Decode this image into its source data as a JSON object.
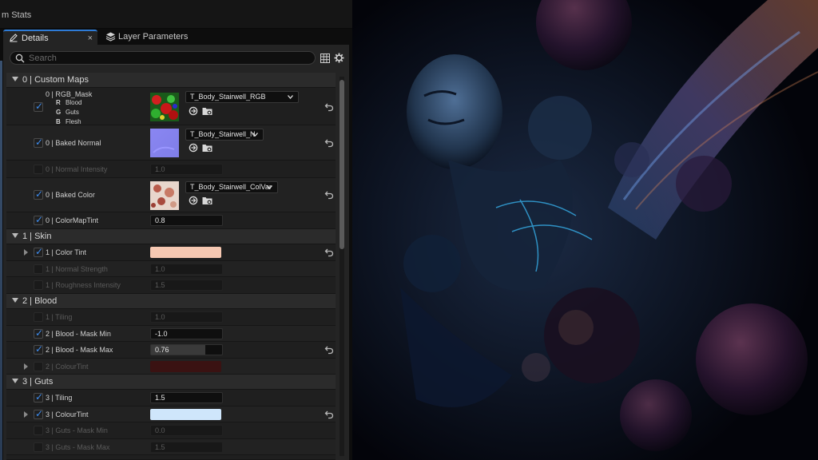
{
  "topbar": {
    "title": "m Stats"
  },
  "tabs": {
    "details": {
      "label": "Details",
      "close": "×"
    },
    "layer": {
      "label": "Layer Parameters"
    }
  },
  "search": {
    "placeholder": "Search"
  },
  "categories": {
    "custom_maps": "0 | Custom Maps",
    "skin": "1 | Skin",
    "blood": "2 | Blood",
    "guts": "3 | Guts"
  },
  "rgb_mask": {
    "label": "0 | RGB_Mask",
    "channels": [
      {
        "ch": "R",
        "name": "Blood"
      },
      {
        "ch": "G",
        "name": "Guts"
      },
      {
        "ch": "B",
        "name": "Flesh"
      }
    ],
    "asset": "T_Body_Stairwell_RGB"
  },
  "baked_normal": {
    "label": "0 | Baked Normal",
    "asset": "T_Body_Stairwell_N"
  },
  "normal_intensity": {
    "label": "0 | Normal Intensity",
    "value": "1.0"
  },
  "baked_color": {
    "label": "0 | Baked Color",
    "asset": "T_Body_Stairwell_ColVar"
  },
  "colormap_tint": {
    "label": "0 | ColorMapTint",
    "value": "0.8"
  },
  "skin_color_tint": {
    "label": "1 | Color Tint",
    "color": "#f6c8b2"
  },
  "skin_normal_strength": {
    "label": "1 | Normal Strength",
    "value": "1.0"
  },
  "skin_roughness": {
    "label": "1 | Roughness Intensity",
    "value": "1.5"
  },
  "blood_tiling": {
    "label": "1 | Tiling",
    "value": "1.0"
  },
  "blood_mask_min": {
    "label": "2 | Blood - Mask Min",
    "value": "-1.0"
  },
  "blood_mask_max": {
    "label": "2 | Blood - Mask Max",
    "value": "0.76",
    "fill": 0.76
  },
  "blood_colour_tint": {
    "label": "2 | ColourTint",
    "color": "#3a1212"
  },
  "guts_tiling": {
    "label": "3 | Tiling",
    "value": "1.5"
  },
  "guts_colour_tint": {
    "label": "3 | ColourTint",
    "color": "#cfe6fb"
  },
  "guts_mask_min": {
    "label": "3 | Guts - Mask Min",
    "value": "0.0"
  },
  "guts_mask_max": {
    "label": "3 | Guts - Mask Max",
    "value": "1.5"
  },
  "colors": {
    "accent": "#2e7bd6",
    "check": "#3e8df0",
    "panel": "#242424"
  }
}
